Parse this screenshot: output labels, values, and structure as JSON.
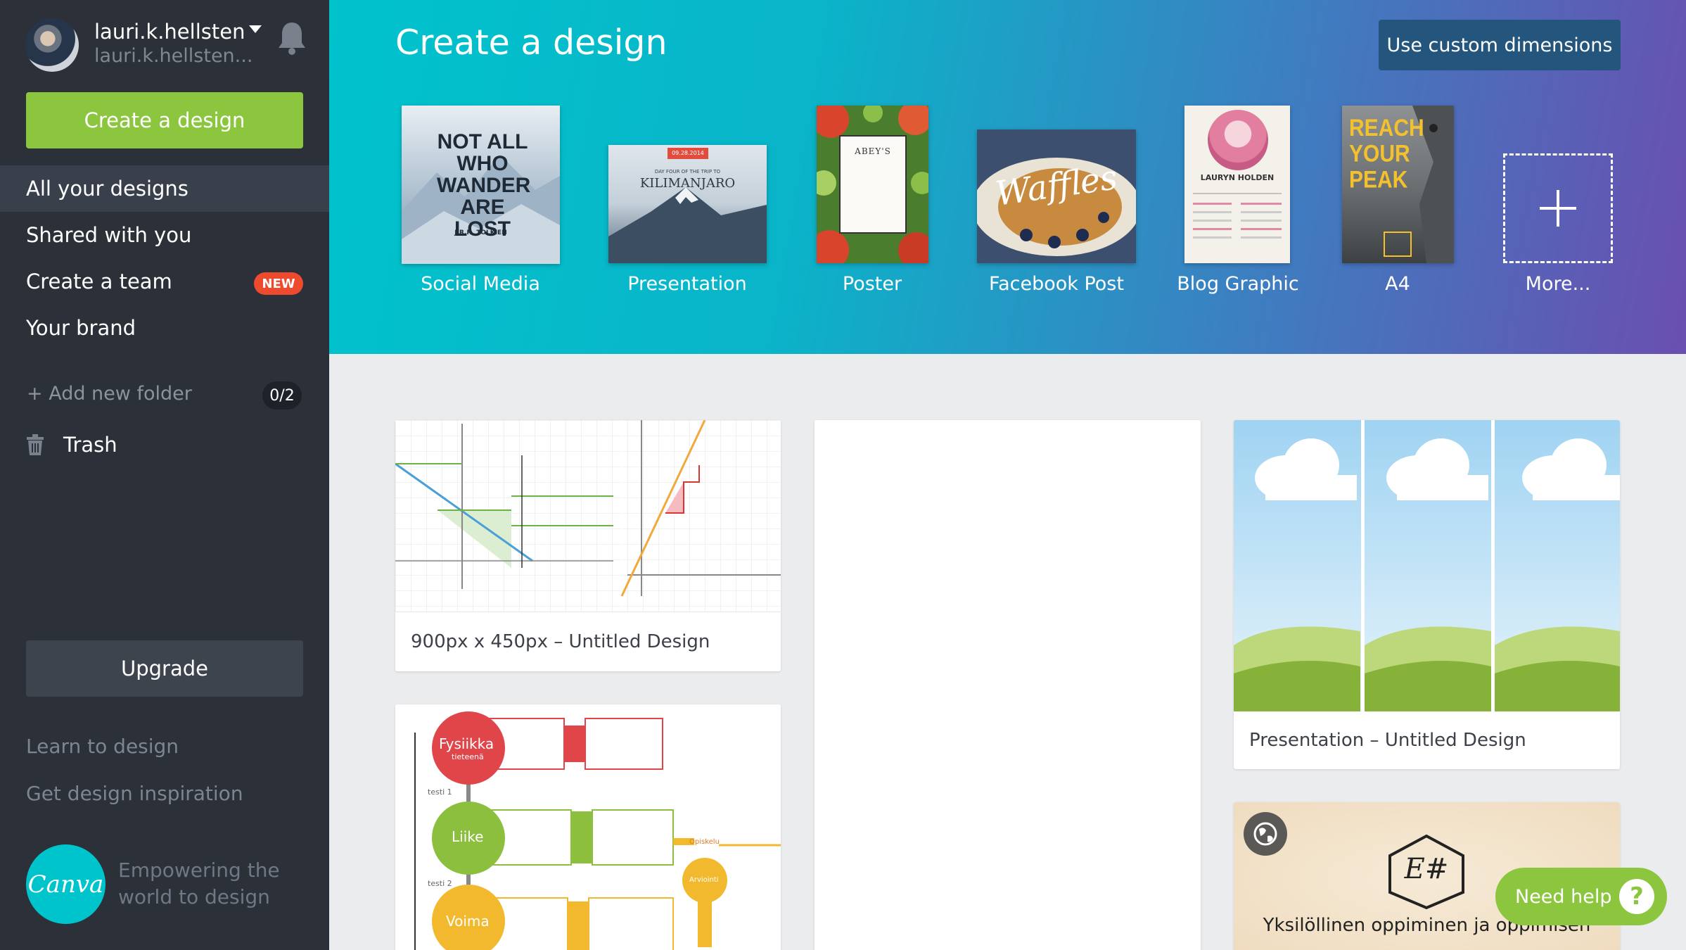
{
  "user": {
    "name": "lauri.k.hellsten",
    "email": "lauri.k.hellsten..."
  },
  "sidebar": {
    "create_label": "Create a design",
    "items": [
      {
        "label": "All your designs",
        "active": true
      },
      {
        "label": "Shared with you"
      },
      {
        "label": "Create a team",
        "badge": "NEW"
      },
      {
        "label": "Your brand"
      }
    ],
    "add_folder": "+ Add new folder",
    "folder_count": "0/2",
    "trash": "Trash",
    "upgrade": "Upgrade",
    "learn": "Learn to design",
    "inspiration": "Get design inspiration",
    "logo_text": "Canva",
    "tagline_1": "Empowering the",
    "tagline_2": "world to design"
  },
  "header": {
    "title": "Create a design",
    "custom_button": "Use custom dimensions",
    "templates": [
      {
        "label": "Social Media",
        "thumb_text": "NOT ALL WHO WANDER ARE LOST",
        "thumb_sub": "J.R.R. TOLKIEN"
      },
      {
        "label": "Presentation",
        "thumb_text": "KILIMANJARO",
        "thumb_sub": "DAY FOUR OF THE TRIP TO",
        "thumb_date": "09.28.2014"
      },
      {
        "label": "Poster",
        "thumb_text": "ABEY'S"
      },
      {
        "label": "Facebook Post",
        "thumb_text": "Waffles"
      },
      {
        "label": "Blog Graphic",
        "thumb_text": "LAURYN HOLDEN"
      },
      {
        "label": "A4",
        "thumb_text": "REACH YOUR PEAK"
      },
      {
        "label": "More..."
      }
    ]
  },
  "designs": [
    {
      "title": "900px x 450px – Untitled Design"
    },
    {
      "title": ""
    },
    {
      "title": "Presentation – Untitled Design"
    },
    {
      "title": "",
      "labels": [
        "Fysiikka",
        "tieteenä",
        "Liike",
        "Voima",
        "testi 1",
        "testi 2",
        "Opiskelu",
        "Arviointi"
      ]
    },
    {
      "title": "",
      "banner": "Yksilöllinen oppiminen ja oppimisen",
      "logo": "E#"
    }
  ],
  "help": {
    "label": "Need help",
    "icon": "?"
  },
  "colors": {
    "accent_green": "#8cc63f",
    "sidebar": "#2b3039",
    "canva_teal": "#00c4cc",
    "badge_red": "#ee4a2e"
  }
}
